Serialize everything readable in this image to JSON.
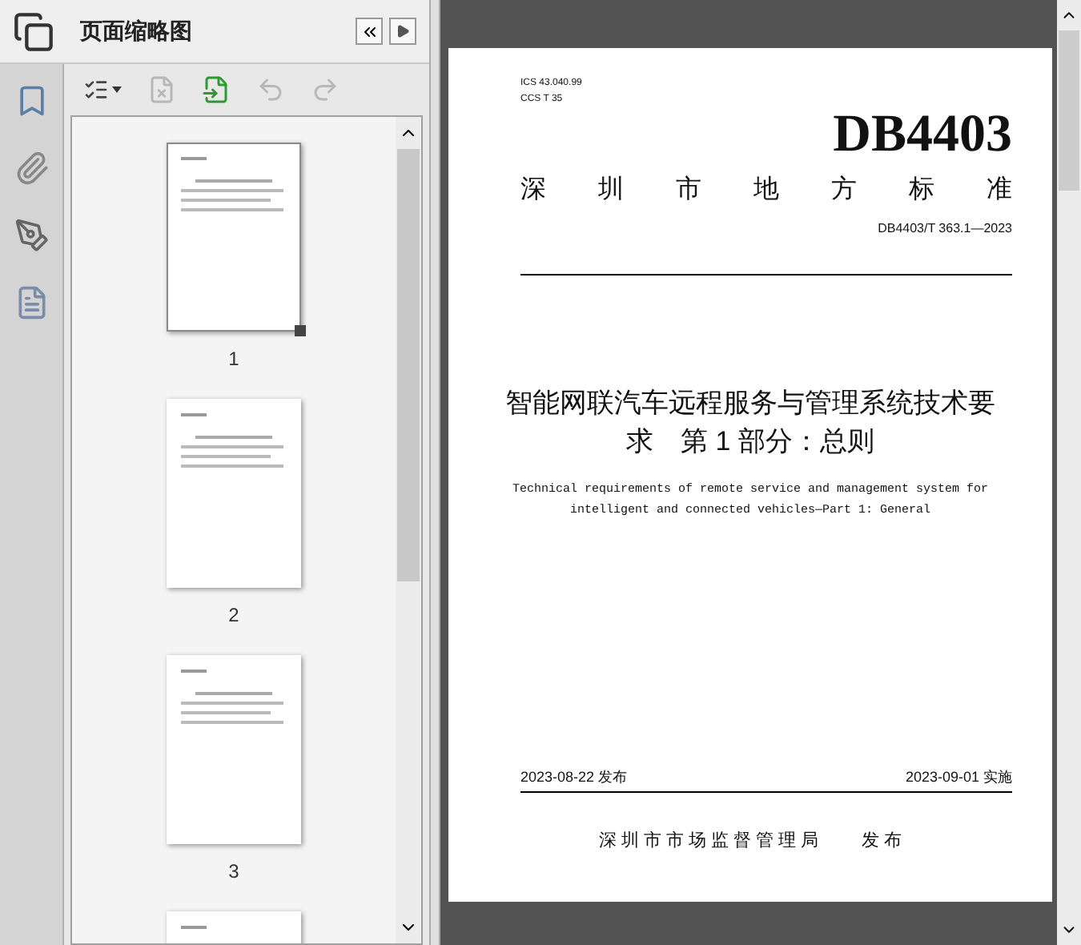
{
  "sidebar": {
    "title": "页面缩略图",
    "thumbnails": [
      {
        "page": "1",
        "selected": true
      },
      {
        "page": "2",
        "selected": false
      },
      {
        "page": "3",
        "selected": false
      },
      {
        "selected": false
      }
    ],
    "toolbar": [
      {
        "kind": "options",
        "disabled": false
      },
      {
        "kind": "delete",
        "disabled": true
      },
      {
        "kind": "insert",
        "disabled": false
      },
      {
        "kind": "undo",
        "disabled": true
      },
      {
        "kind": "redo",
        "disabled": true
      }
    ]
  },
  "document": {
    "ics": "ICS 43.040.99",
    "ccs": "CCS T 35",
    "code": "DB4403",
    "standard_type": [
      "深",
      "圳",
      "市",
      "地",
      "方",
      "标",
      "准"
    ],
    "number": "DB4403/T 363.1—2023",
    "title": "智能网联汽车远程服务与管理系统技术要求　第 1 部分：总则",
    "english_title": "Technical requirements of remote service and management system for intelligent and connected vehicles—Part 1: General",
    "issue_date": "2023-08-22 发布",
    "effective_date": "2023-09-01 实施",
    "publisher": "深圳市市场监督管理局",
    "publish_word": "发 布"
  }
}
